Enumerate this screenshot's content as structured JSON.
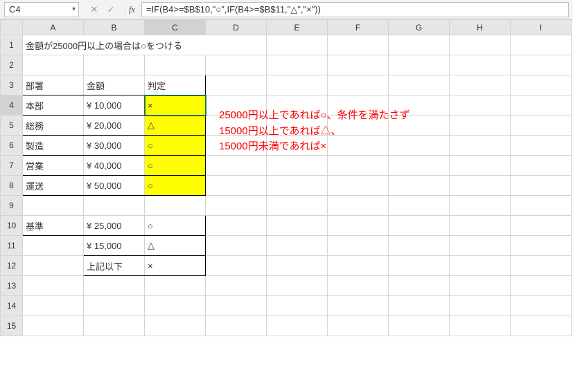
{
  "nameBox": "C4",
  "formulaBar": "=IF(B4>=$B$10,\"○\",IF(B4>=$B$11,\"△\",\"×\"))",
  "icons": {
    "dropdown": "▾",
    "cancel": "✕",
    "confirm": "✓",
    "fx": "fx"
  },
  "columns": [
    "A",
    "B",
    "C",
    "D",
    "E",
    "F",
    "G",
    "H",
    "I"
  ],
  "rows": [
    "1",
    "2",
    "3",
    "4",
    "5",
    "6",
    "7",
    "8",
    "9",
    "10",
    "11",
    "12",
    "13",
    "14",
    "15"
  ],
  "activeCell": "C4",
  "cells": {
    "A1": "金額が25000円以上の場合は○をつける",
    "A3": "部署",
    "B3": "金額",
    "C3": "判定",
    "A4": "本部",
    "B4": "¥ 10,000",
    "C4": "×",
    "A5": "総務",
    "B5": "¥ 20,000",
    "C5": "△",
    "A6": "製造",
    "B6": "¥ 30,000",
    "C6": "○",
    "A7": "営業",
    "B7": "¥ 40,000",
    "C7": "○",
    "A8": "運送",
    "B8": "¥ 50,000",
    "C8": "○",
    "A10": "基準",
    "B10": "¥ 25,000",
    "C10": "○",
    "B11": "¥ 15,000",
    "C11": "△",
    "B12": "上記以下",
    "C12": "×"
  },
  "annotation": {
    "line1": "25000円以上であれば○、条件を満たさず",
    "line2": "15000円以上であれば△、",
    "line3": "15000円未満であれば×"
  }
}
